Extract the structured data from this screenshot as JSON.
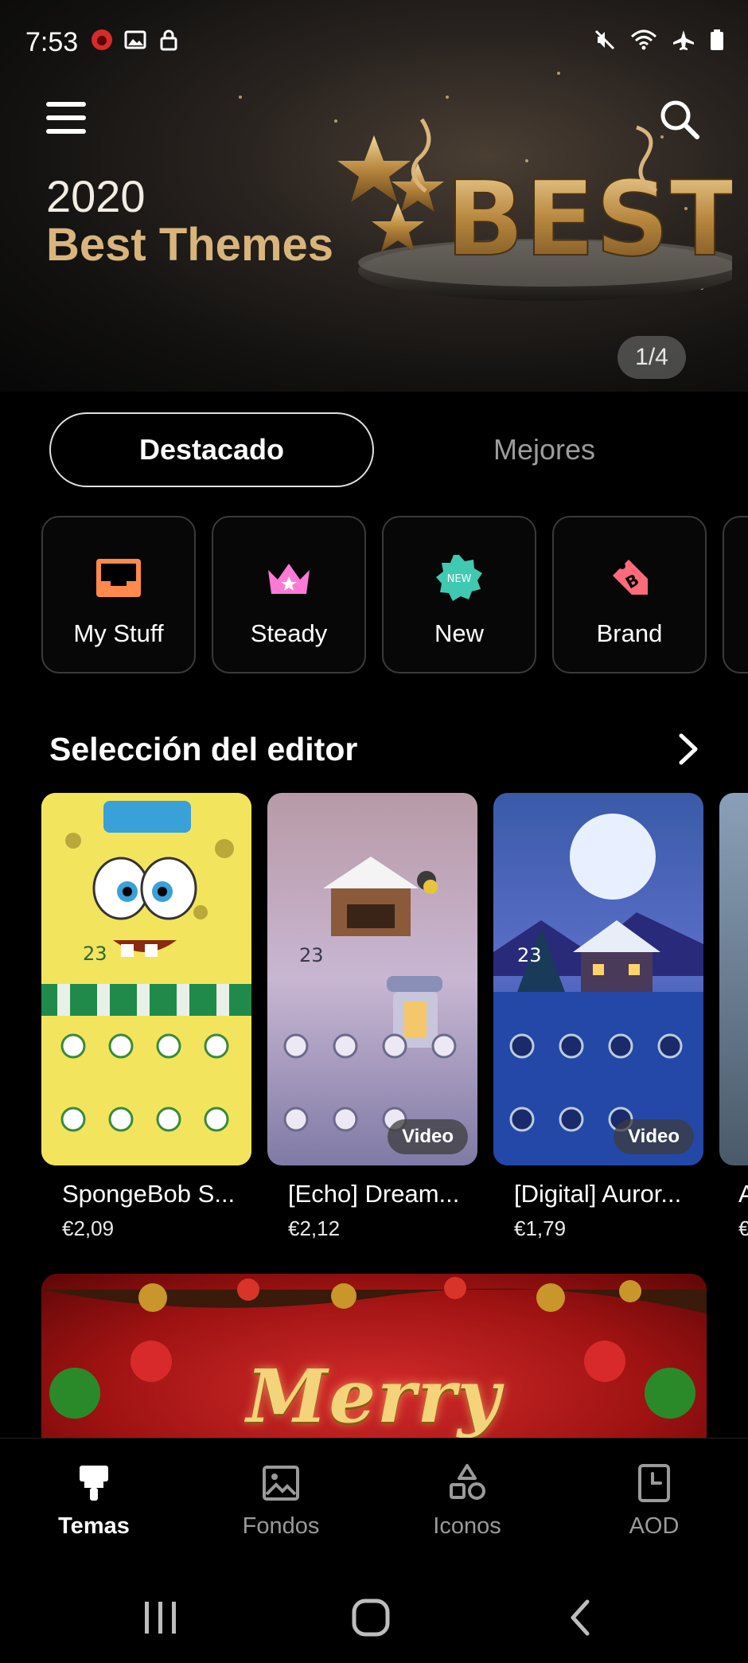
{
  "status_bar": {
    "time": "7:53",
    "left_icons": [
      "notification-badge-icon",
      "image-icon",
      "lock-icon"
    ],
    "right_icons": [
      "mute-icon",
      "wifi-icon",
      "airplane-icon",
      "battery-icon"
    ]
  },
  "banner": {
    "year": "2020",
    "title": "Best Themes",
    "art_text": "BEST",
    "pager": "1/4"
  },
  "tabs": {
    "active": "Destacado",
    "inactive": "Mejores"
  },
  "categories": [
    {
      "label": "My Stuff",
      "icon": "inbox-tray-icon",
      "color": "#ff8a4c"
    },
    {
      "label": "Steady",
      "icon": "crown-icon",
      "color": "#ff7ad6"
    },
    {
      "label": "New",
      "icon": "new-badge-icon",
      "color": "#3fc9b0",
      "badge_text": "NEW"
    },
    {
      "label": "Brand",
      "icon": "brand-tag-icon",
      "color": "#ff6b7a",
      "badge_text": "B"
    }
  ],
  "editor_section": {
    "title": "Selección del editor",
    "themes": [
      {
        "name": "SpongeBob S...",
        "price": "€2,09",
        "video": "",
        "thumb_weather": "23"
      },
      {
        "name": "[Echo] Dream...",
        "price": "€2,12",
        "video": "Video",
        "thumb_weather": "23"
      },
      {
        "name": "[Digital] Auror...",
        "price": "€1,79",
        "video": "Video",
        "thumb_weather": "23"
      },
      {
        "name": "A",
        "price": "€",
        "video": "",
        "thumb_weather": ""
      }
    ]
  },
  "promo": {
    "text": "Merry Christmas"
  },
  "bottom_nav": [
    {
      "label": "Temas",
      "icon": "brush-icon",
      "active": true
    },
    {
      "label": "Fondos",
      "icon": "image-icon",
      "active": false
    },
    {
      "label": "Iconos",
      "icon": "shapes-icon",
      "active": false
    },
    {
      "label": "AOD",
      "icon": "clock-icon",
      "active": false
    }
  ],
  "colors": {
    "background": "#000000",
    "banner_gold": "#d9b57c",
    "active_tab_border": "#e0e0e0",
    "inactive_text": "#9c9c9c"
  }
}
